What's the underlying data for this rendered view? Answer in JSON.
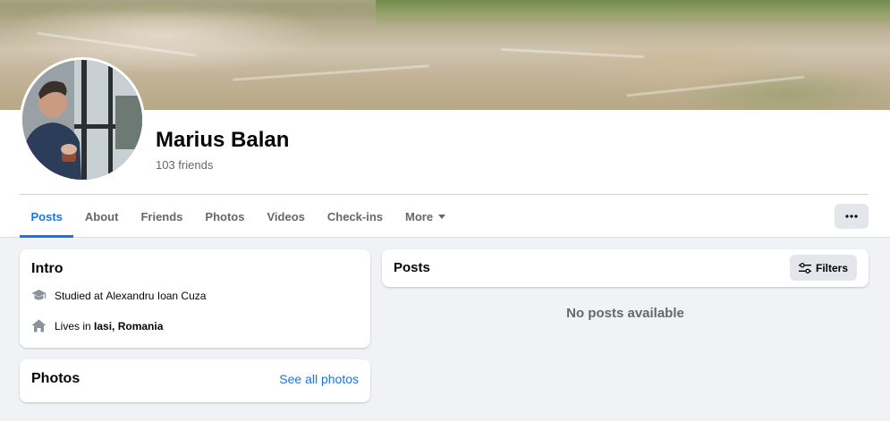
{
  "profile": {
    "name": "Marius Balan",
    "friends": "103 friends"
  },
  "tabs": [
    {
      "label": "Posts",
      "active": true
    },
    {
      "label": "About",
      "active": false
    },
    {
      "label": "Friends",
      "active": false
    },
    {
      "label": "Photos",
      "active": false
    },
    {
      "label": "Videos",
      "active": false
    },
    {
      "label": "Check-ins",
      "active": false
    },
    {
      "label": "More",
      "active": false
    }
  ],
  "more_button": {
    "label": "···"
  },
  "intro": {
    "title": "Intro",
    "studied_prefix": "Studied at ",
    "studied_at": "Alexandru Ioan Cuza",
    "lives_prefix": "Lives in ",
    "lives_in": "Iasi, Romania"
  },
  "photos": {
    "title": "Photos",
    "see_all": "See all photos"
  },
  "posts": {
    "title": "Posts",
    "filters_label": "Filters",
    "empty_message": "No posts available"
  },
  "colors": {
    "accent": "#1b74e4",
    "secondary_text": "#65676b",
    "page_background": "#f0f2f5"
  },
  "icons": {
    "education": "graduation-cap-icon",
    "home": "home-icon",
    "filters": "sliders-icon",
    "more": "ellipsis-icon",
    "dropdown": "caret-down-icon"
  }
}
